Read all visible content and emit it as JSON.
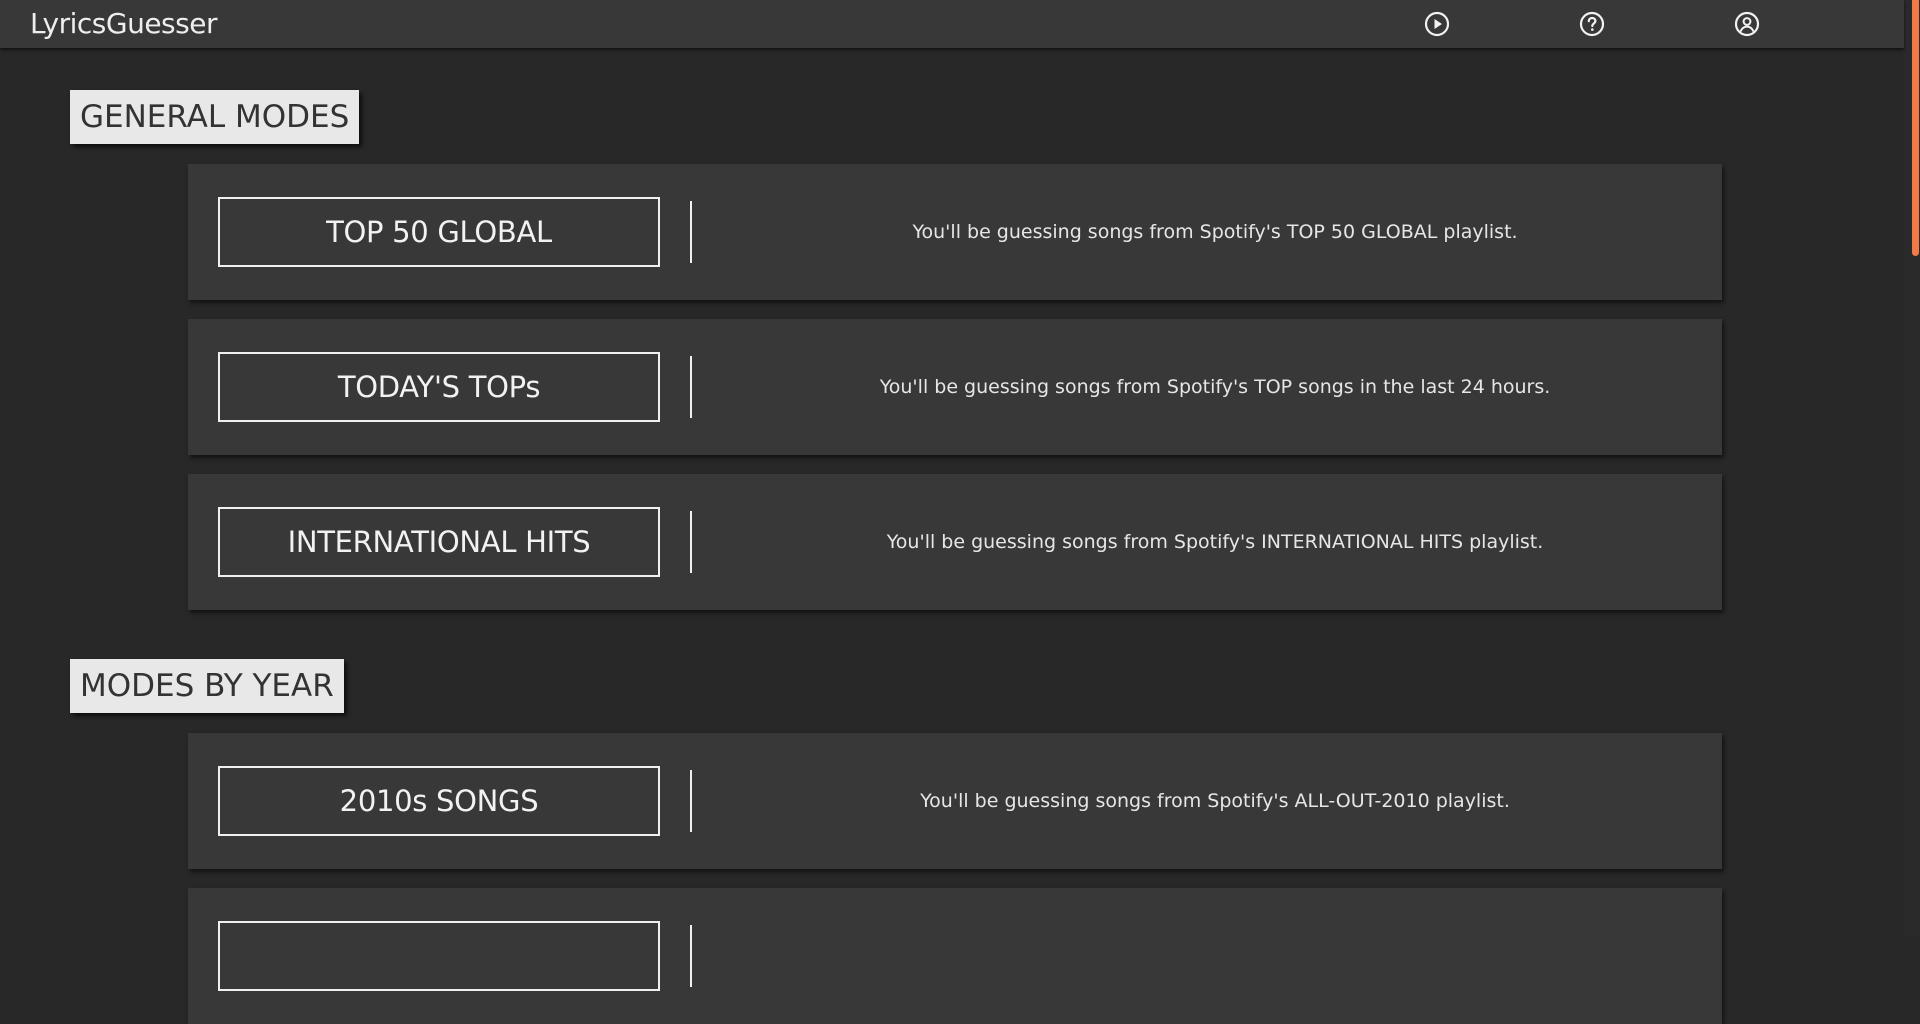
{
  "app": {
    "title": "LyricsGuesser"
  },
  "nav": {
    "icons": [
      "play-circle-icon",
      "help-circle-icon",
      "account-circle-icon"
    ]
  },
  "colors": {
    "background": "#282828",
    "card": "#383838",
    "heading_bg": "#e8e8e8",
    "accent_scrollbar": "#f07a48"
  },
  "sections": [
    {
      "heading": "GENERAL MODES",
      "modes": [
        {
          "label": "TOP 50 GLOBAL",
          "description": "You'll be guessing songs from Spotify's TOP 50 GLOBAL playlist."
        },
        {
          "label": "TODAY'S TOPs",
          "description": "You'll be guessing songs from Spotify's TOP songs in the last 24 hours."
        },
        {
          "label": "INTERNATIONAL HITS",
          "description": "You'll be guessing songs from Spotify's INTERNATIONAL HITS playlist."
        }
      ]
    },
    {
      "heading": "MODES BY YEAR",
      "modes": [
        {
          "label": "2010s SONGS",
          "description": "You'll be guessing songs from Spotify's ALL-OUT-2010 playlist."
        },
        {
          "label": "",
          "description": ""
        }
      ]
    }
  ]
}
